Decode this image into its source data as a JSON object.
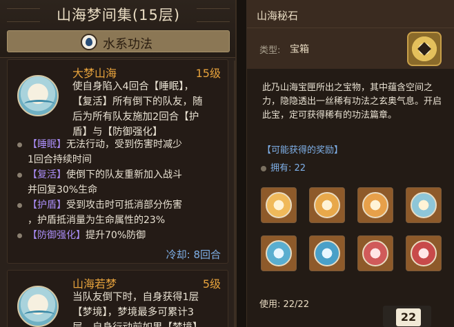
{
  "left": {
    "title": "山海梦间集(15层)",
    "school": "水系功法",
    "skills": [
      {
        "name": "大梦山海",
        "level": "15级",
        "desc": [
          "使自身陷入4回合【睡眠】，",
          "【复活】所有倒下的队友，随",
          "后为所有队友施加2回合【护",
          "盾】与【防御强化】"
        ],
        "effects": [
          {
            "tag": "【睡眠】",
            "text": "无法行动，受到伤害时减少",
            "cont": "1回合持续时间"
          },
          {
            "tag": "【复活】",
            "text": "使倒下的队友重新加入战斗",
            "cont": "并回复30%生命"
          },
          {
            "tag": "【护盾】",
            "text": "受到攻击时可抵消部分伤害",
            "cont": "，护盾抵消量为生命属性的23%"
          },
          {
            "tag": "【防御强化】",
            "text": "提升70%防御",
            "cont": ""
          }
        ],
        "cooldown": "冷却: 8回合"
      },
      {
        "name": "山海若梦",
        "level": "5级",
        "desc": [
          "当队友倒下时，自身获得1层",
          "【梦境】，梦境最多可累计3",
          "层，自身行动前如果【梦境】"
        ]
      }
    ]
  },
  "right": {
    "title": "山海秘石",
    "type_label": "类型:",
    "type_value": "宝箱",
    "desc": "此乃山海宝匣所出之宝物，其中蕴含空间之力，隐隐透出一丝稀有功法之玄奥气息。开启此宝，定可获得稀有的功法篇章。",
    "reward_title": "【可能获得的奖励】",
    "own": "拥有: 22",
    "use": "使用: 22/22",
    "use_count": "22"
  }
}
